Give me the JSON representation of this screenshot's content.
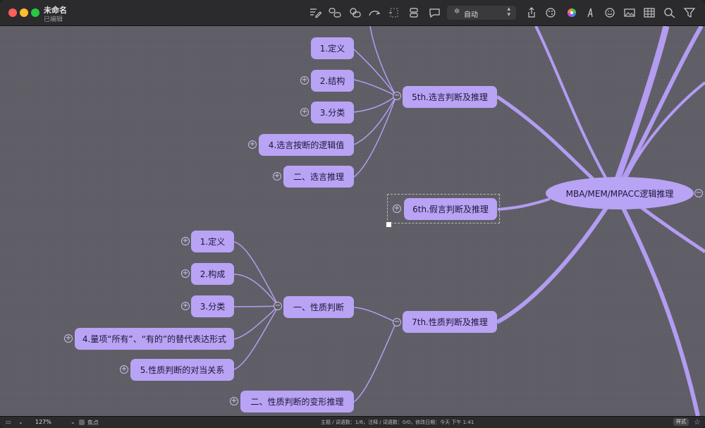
{
  "window": {
    "title": "未命名",
    "subtitle": "已编辑"
  },
  "toolbar": {
    "icons": [
      "note-icon",
      "relationship-icon",
      "boundary-icon",
      "redo-icon",
      "summary-icon",
      "insert-topic-icon",
      "comment-icon",
      "share-icon",
      "palette-icon",
      "color-wheel-icon",
      "font-icon",
      "emoji-icon",
      "image-icon",
      "table-icon",
      "search-icon",
      "filter-icon"
    ],
    "layout_dropdown": {
      "icon": "✲",
      "value": "自动"
    }
  },
  "mindmap": {
    "root": "MBA/MEM/MPACC逻辑推理",
    "branch5": {
      "label": "5th.选言判断及推理",
      "children": [
        "1.定义",
        "2.结构",
        "3.分类",
        "4.选言按断的逻辑值",
        "二、选言推理"
      ]
    },
    "branch6": {
      "label": "6th.假言判断及推理"
    },
    "branch7": {
      "label": "7th.性质判断及推理",
      "sub1": {
        "label": "一、性质判断",
        "children": [
          "1.定义",
          "2.构成",
          "3.分类",
          "4.量项“所有”、“有的”的替代表达形式",
          "5.性质判断的对当关系"
        ]
      },
      "sub2": {
        "label": "二、性质判断的变形推理"
      }
    },
    "colors": {
      "node": "#b9a3f5",
      "line": "#b39cf2",
      "canvas": "#5f5e66"
    }
  },
  "statusbar": {
    "zoom": "127%",
    "focus_label": "焦点",
    "stats": "主题 / 词语数：1/6，注释 / 词语数：0/0，修改日期：今天 下午 1:41",
    "style_button": "样式"
  }
}
